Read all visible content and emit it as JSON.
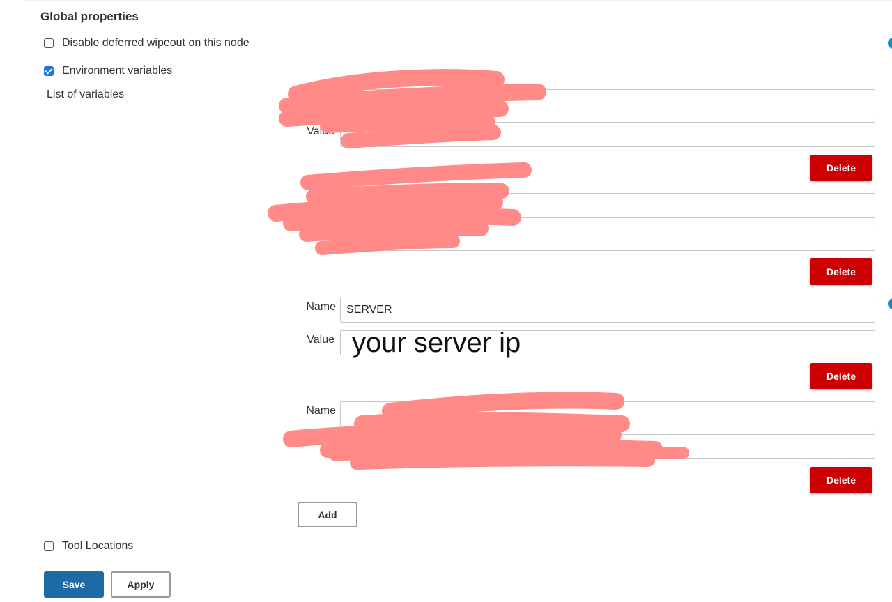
{
  "section": {
    "title": "Global properties"
  },
  "options": {
    "deferred_wipeout": {
      "label": "Disable deferred wipeout on this node",
      "checked": false
    },
    "env_vars": {
      "label": "Environment variables",
      "checked": true
    },
    "tool_locations": {
      "label": "Tool Locations",
      "checked": false
    }
  },
  "list_label": "List of variables",
  "variables": [
    {
      "name_label": "",
      "value_label": "Value",
      "name": "",
      "value": "",
      "redacted": true,
      "delete_label": "Delete"
    },
    {
      "name_label": "",
      "value_label": "",
      "name": "",
      "value": "",
      "redacted": true,
      "delete_label": "Delete"
    },
    {
      "name_label": "Name",
      "value_label": "Value",
      "name": "SERVER",
      "value": "your server ip",
      "redacted": false,
      "delete_label": "Delete"
    },
    {
      "name_label": "Name",
      "value_label": "",
      "name": "",
      "value": "",
      "redacted": true,
      "delete_label": "Delete"
    }
  ],
  "buttons": {
    "add": "Add",
    "save": "Save",
    "apply": "Apply"
  },
  "colors": {
    "delete": "#cc0000",
    "save": "#1d6aa5",
    "checkbox_checked": "#1a73e8",
    "help_icon": "#138ad4",
    "redaction": "#ff8a87"
  }
}
